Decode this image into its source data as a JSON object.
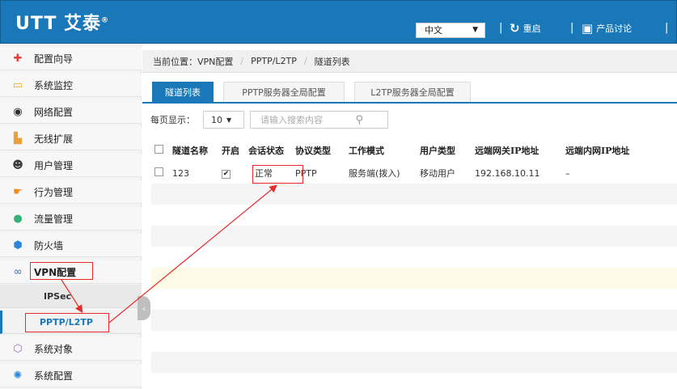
{
  "header": {
    "logo_text": "UTT 艾泰",
    "language": "中文",
    "links": [
      {
        "label": "重启",
        "icon": "restart-icon"
      },
      {
        "label": "产品讨论",
        "icon": "chat-icon"
      }
    ]
  },
  "sidebar": {
    "items": [
      {
        "label": "配置向导",
        "icon": "wizard-icon",
        "color": "#e0403a"
      },
      {
        "label": "系统监控",
        "icon": "monitor-icon",
        "color": "#f0a81e"
      },
      {
        "label": "网络配置",
        "icon": "network-icon",
        "color": "#2e2e2e"
      },
      {
        "label": "无线扩展",
        "icon": "wireless-icon",
        "color": "#e9a23b"
      },
      {
        "label": "用户管理",
        "icon": "users-icon",
        "color": "#3a3a3a"
      },
      {
        "label": "行为管理",
        "icon": "hand-icon",
        "color": "#f08a1c"
      },
      {
        "label": "流量管理",
        "icon": "traffic-icon",
        "color": "#35b27a"
      },
      {
        "label": "防火墙",
        "icon": "shield-icon",
        "color": "#2b87d6"
      },
      {
        "label": "VPN配置",
        "icon": "vpn-icon",
        "color": "#6c8fb8"
      }
    ],
    "sub_items": [
      {
        "label": "IPSec"
      },
      {
        "label": "PPTP/L2TP"
      }
    ],
    "bottom_items": [
      {
        "label": "系统对象",
        "icon": "cube-icon",
        "color": "#9a6cc2"
      },
      {
        "label": "系统配置",
        "icon": "gear-icon",
        "color": "#2b87d6"
      }
    ]
  },
  "breadcrumb": {
    "prefix": "当前位置：",
    "parts": [
      "VPN配置",
      "PPTP/L2TP",
      "隧道列表"
    ]
  },
  "tabs": [
    {
      "label": "隧道列表",
      "active": true
    },
    {
      "label": "PPTP服务器全局配置",
      "active": false
    },
    {
      "label": "L2TP服务器全局配置",
      "active": false
    }
  ],
  "toolbar": {
    "page_size_label": "每页显示：",
    "page_size_value": "10",
    "search_placeholder": "请输入搜索内容"
  },
  "table": {
    "columns": [
      "隧道名称",
      "开启",
      "会话状态",
      "协议类型",
      "工作模式",
      "用户类型",
      "远端网关IP地址",
      "远端内网IP地址"
    ],
    "rows": [
      {
        "name": "123",
        "enabled": true,
        "status": "正常",
        "protocol": "PPTP",
        "mode": "服务端(拨入)",
        "user_type": "移动用户",
        "remote_gw": "192.168.10.11",
        "remote_lan": "–"
      }
    ]
  },
  "colors": {
    "header_bg": "#1a78b8",
    "annotation": "#e52b2b"
  }
}
